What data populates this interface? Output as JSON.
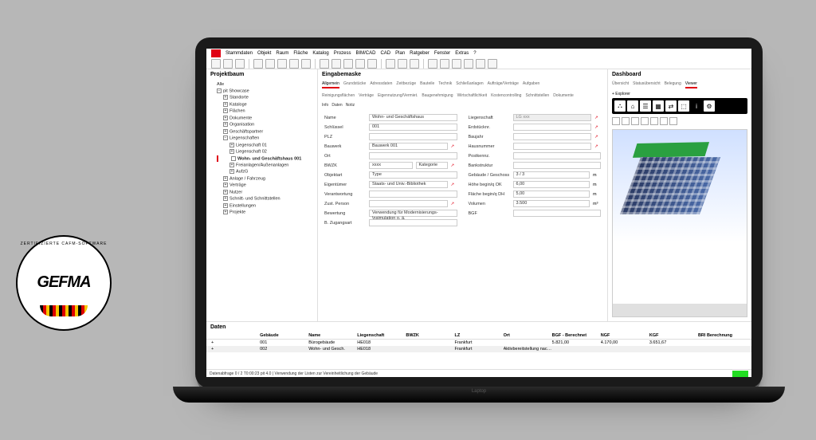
{
  "badge": {
    "org": "GEFMA",
    "arc": "ZERTIFIZIERTE CAFM-SOFTWARE"
  },
  "menu": [
    "Stammdaten",
    "Objekt",
    "Raum",
    "Fläche",
    "Katalog",
    "Prozess",
    "BIM/CAD",
    "CAD",
    "Plan",
    "Ratgeber",
    "Fenster",
    "Extras",
    "?"
  ],
  "tree_title": "Projektbaum",
  "tree": [
    "Alle",
    "− pit Showcase",
    "  + Standorte",
    "  + Kataloge",
    "  + Flächen",
    "  + Dokumente",
    "  + Organisation",
    "  + Geschäftspartner",
    "  − Liegenschaften",
    "    + Liegenschaft 01",
    "    + Liegenschaft 02",
    "    * Wohn- und Geschäftshaus 001",
    "    + Freianlagen/Außenanlagen",
    "    + AufzG",
    "  + Anlage / Fahrzeug",
    "  + Verträge",
    "  + Nutzer",
    "  + Schnitt- und Schnittstellen",
    "  + Einstellungen",
    "  + Projekte"
  ],
  "mid_title": "Eingabemaske",
  "mid_tabs_row1": [
    "Allgemein",
    "Grundstücke",
    "Adressdaten",
    "Zeitbezüge",
    "Bauteile",
    "Technik",
    "Schließanlagen",
    "Aufträge/Verträge",
    "Aufgaben"
  ],
  "mid_tabs_row2": [
    "Reinigungsflächen",
    "Verträge",
    "Eigennutzung/Vermiet.",
    "Baugenehmigung",
    "Wirtschaftlichkeit",
    "Kostencontrolling",
    "Schnittstellen",
    "Dokumente"
  ],
  "mid_sub": [
    "Info",
    "Daten",
    "Notiz"
  ],
  "mid_active": 0,
  "form_left": [
    {
      "l": "Name",
      "v": "Wohn- und Geschäftshaus"
    },
    {
      "l": "Schlüssel",
      "v": "001"
    },
    {
      "l": "PLZ",
      "v": ""
    },
    {
      "l": "Bauwerk",
      "v": "Bauwerk 001",
      "ext": true
    },
    {
      "l": "Ort",
      "v": ""
    },
    {
      "l": "BWZK",
      "v": "xxxx",
      "ext": true,
      "extra": "Kategorie"
    },
    {
      "l": "Objektart",
      "v": "Type"
    },
    {
      "l": "Eigentümer",
      "v": "Staats- und Univ.-Bibliothek",
      "ext": true
    },
    {
      "l": "Verantwortung",
      "v": ""
    },
    {
      "l": "Zust. Person",
      "v": "",
      "ext": true
    },
    {
      "l": "Bewertung",
      "v": "Verwendung für Modernisierungs-\\nsimulation o. ä."
    },
    {
      "l": "B. Zugangsart",
      "v": ""
    }
  ],
  "form_right": [
    {
      "l": "Liegenschaft",
      "v": "LG xxx",
      "ro": true,
      "ext": true
    },
    {
      "l": "Erdstücknr.",
      "v": "",
      "ext": true
    },
    {
      "l": "Baujahr",
      "v": "",
      "ext": true
    },
    {
      "l": "Hausnummer",
      "v": "",
      "ext": true
    },
    {
      "l": "Postkennz.",
      "v": ""
    },
    {
      "l": "Bankstruktur",
      "v": ""
    },
    {
      "l": "Gebäude / Geschoss",
      "v": "3 / 3",
      "u": "m"
    },
    {
      "l": "Höhe  begin/q OK",
      "v": "6,00",
      "u": "m"
    },
    {
      "l": "Fläche  begin/q DH",
      "v": "5,00",
      "u": "m"
    },
    {
      "l": "Volumen",
      "v": "3.500",
      "u": "m³"
    },
    {
      "l": "BGF",
      "v": ""
    }
  ],
  "dash_title": "Dashboard",
  "dash_tabs": [
    "Übersicht",
    "Statusübersicht",
    "Belegung",
    "Viewer"
  ],
  "dash_tab_active": 3,
  "dash_sub": "+ Explorer",
  "viewer_icons": [
    "⌂",
    "☰",
    "▦",
    "⇄",
    "⬚",
    "●"
  ],
  "grid_title": "Daten",
  "grid_cols": [
    "",
    "Gebäude",
    "Name",
    "Liegenschaft",
    "BWZK",
    "LZ",
    "Ort",
    "BGF - Berechnet",
    "NGF",
    "KGF",
    "BRI  Berechnung"
  ],
  "grid_rows": [
    [
      "+",
      "001",
      "Bürogebäude",
      "HE018",
      "",
      "Frankfurt",
      "",
      "5.821,00",
      "4.170,00",
      "3.651,67",
      ""
    ],
    [
      "+",
      "002",
      "Wohn- und Gesch.",
      "HE018",
      "",
      "Frankfurt",
      "Aktivbereitstellung nach Hochrechnung der gebäudetypischen Referenzwerte",
      "",
      "",
      "",
      ""
    ]
  ],
  "status_left": "Datenabfrage 0 / 2  T0:00:23  pit 4.0  | Verwendung der Listen zur Vereinheitlichung der Gebäude",
  "status_right": ""
}
